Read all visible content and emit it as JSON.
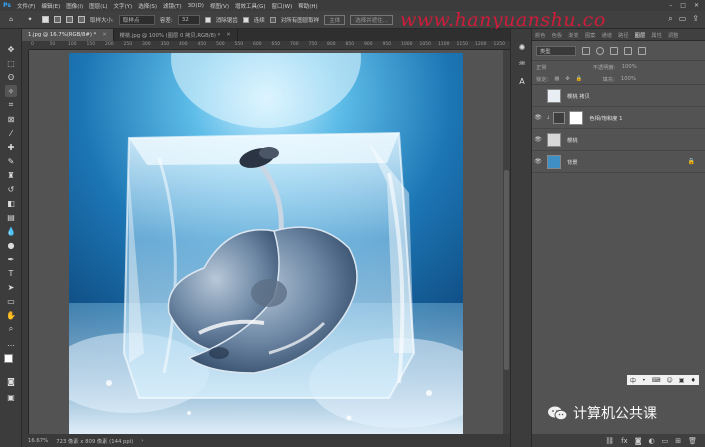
{
  "menu": [
    "文件(F)",
    "编辑(E)",
    "图像(I)",
    "图层(L)",
    "文字(Y)",
    "选择(S)",
    "滤镜(T)",
    "3D(D)",
    "视图(V)",
    "增效工具(G)",
    "窗口(W)",
    "帮助(H)"
  ],
  "app_icon": "Ps",
  "options": {
    "sample_size_label": "取样大小:",
    "sample_size_value": "取样点",
    "tolerance_label": "容差:",
    "tolerance_value": "32",
    "anti_alias": "消除锯齿",
    "contiguous": "连续",
    "sample_all": "对所有图层取样",
    "subject_button": "主体",
    "select_mask_button": "选择并遮住..."
  },
  "watermark": "www.hanyuanshu.co",
  "tabs": [
    {
      "label": "1.jpg @ 16.7%(RGB/8#) *",
      "active": true
    },
    {
      "label": "樱桃.jpg @ 100% (图层 0 拷贝,RGB/8) *",
      "active": false
    }
  ],
  "ruler_ticks": [
    "0",
    "50",
    "100",
    "150",
    "200",
    "250",
    "300",
    "350",
    "400",
    "450",
    "500",
    "550",
    "600",
    "650",
    "700",
    "750",
    "800",
    "850",
    "900",
    "950",
    "1000",
    "1050",
    "1100",
    "1150",
    "1200",
    "1250"
  ],
  "status": {
    "zoom": "16.67%",
    "size": "723 像素 x 809 像素 (144 ppi)"
  },
  "panel_tabs": [
    "颜色",
    "色板",
    "渐变",
    "图案",
    "通道",
    "路径",
    "图层",
    "属性",
    "调整"
  ],
  "layers_filter": {
    "kind": "类型"
  },
  "layers_opts": {
    "blend": "正常",
    "opacity_label": "不透明度:",
    "opacity": "100%",
    "lock_label": "锁定:",
    "fill_label": "填充:",
    "fill": "100%"
  },
  "layers": [
    {
      "name": "樱桃 拷贝",
      "visible": false,
      "kind": "cherry"
    },
    {
      "name": "色相/饱和度 1",
      "visible": true,
      "kind": "adjustment"
    },
    {
      "name": "樱桃",
      "visible": true,
      "kind": "cherry"
    },
    {
      "name": "背景",
      "visible": true,
      "kind": "background",
      "locked": true
    }
  ],
  "wechat_text": "计算机公共课",
  "mini_icons": [
    "中",
    "•",
    "⌨",
    "☺",
    "▣",
    "♦"
  ],
  "colors": {
    "brand": "#31a8ff",
    "watermark": "#e2183a",
    "bg": "#535353"
  }
}
